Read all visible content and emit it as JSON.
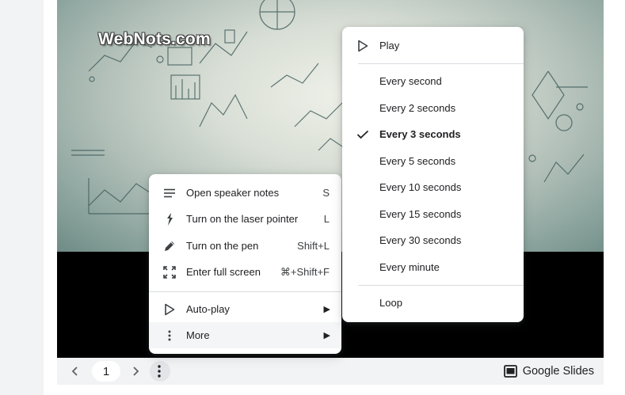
{
  "slide": {
    "logo_text": "WebNots.com"
  },
  "context_menu": {
    "items": [
      {
        "icon": "speaker-notes-icon",
        "label": "Open speaker notes",
        "shortcut": "S"
      },
      {
        "icon": "laser-pointer-icon",
        "label": "Turn on the laser pointer",
        "shortcut": "L"
      },
      {
        "icon": "pen-icon",
        "label": "Turn on the pen",
        "shortcut": "Shift+L"
      },
      {
        "icon": "fullscreen-icon",
        "label": "Enter full screen",
        "shortcut": "⌘+Shift+F"
      }
    ],
    "autoplay_label": "Auto-play",
    "more_label": "More",
    "submenu_arrow": "▶"
  },
  "autoplay_menu": {
    "play_label": "Play",
    "options": [
      "Every second",
      "Every 2 seconds",
      "Every 3 seconds",
      "Every 5 seconds",
      "Every 10 seconds",
      "Every 15 seconds",
      "Every 30 seconds",
      "Every minute"
    ],
    "selected_index": 2,
    "loop_label": "Loop"
  },
  "nav": {
    "prev": "‹",
    "page": "1",
    "next": "›",
    "brand_label": "Google Slides"
  }
}
